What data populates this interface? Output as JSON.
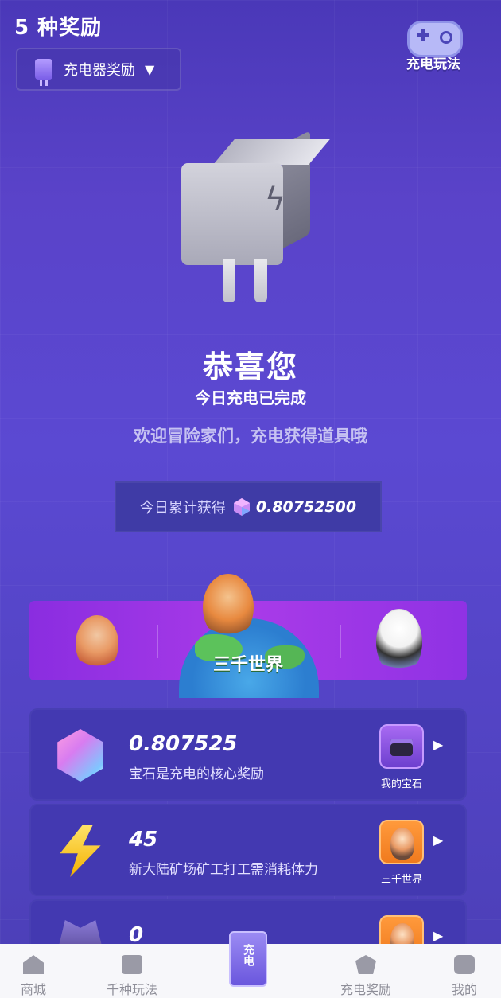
{
  "header": {
    "title": "5 种奖励",
    "game_label": "充电玩法"
  },
  "selector": {
    "label": "充电器奖励",
    "caret": "▼"
  },
  "hero": {
    "headline": "恭喜您",
    "status": "今日充电已完成",
    "message": "欢迎冒险家们，充电获得道具哦"
  },
  "today": {
    "label": "今日累计获得",
    "value": "0.80752500"
  },
  "banner": {
    "title": "三千世界"
  },
  "rewards": [
    {
      "value": "0.807525",
      "description": "宝石是充电的核心奖励",
      "link_label": "我的宝石",
      "icon": "gem-icon"
    },
    {
      "value": "45",
      "description": "新大陆矿场矿工打工需消耗体力",
      "link_label": "三千世界",
      "icon": "lightning-icon"
    },
    {
      "value": "0",
      "description": "",
      "link_label": "",
      "icon": "dark-item-icon"
    }
  ],
  "bottom_nav": {
    "items": [
      {
        "label": "商城",
        "icon": "home-icon"
      },
      {
        "label": "千种玩法",
        "icon": "gamepad-icon"
      },
      {
        "label": "充电",
        "icon": "charger-icon"
      },
      {
        "label": "充电奖励",
        "icon": "reward-icon"
      },
      {
        "label": "我的",
        "icon": "profile-icon"
      }
    ]
  }
}
